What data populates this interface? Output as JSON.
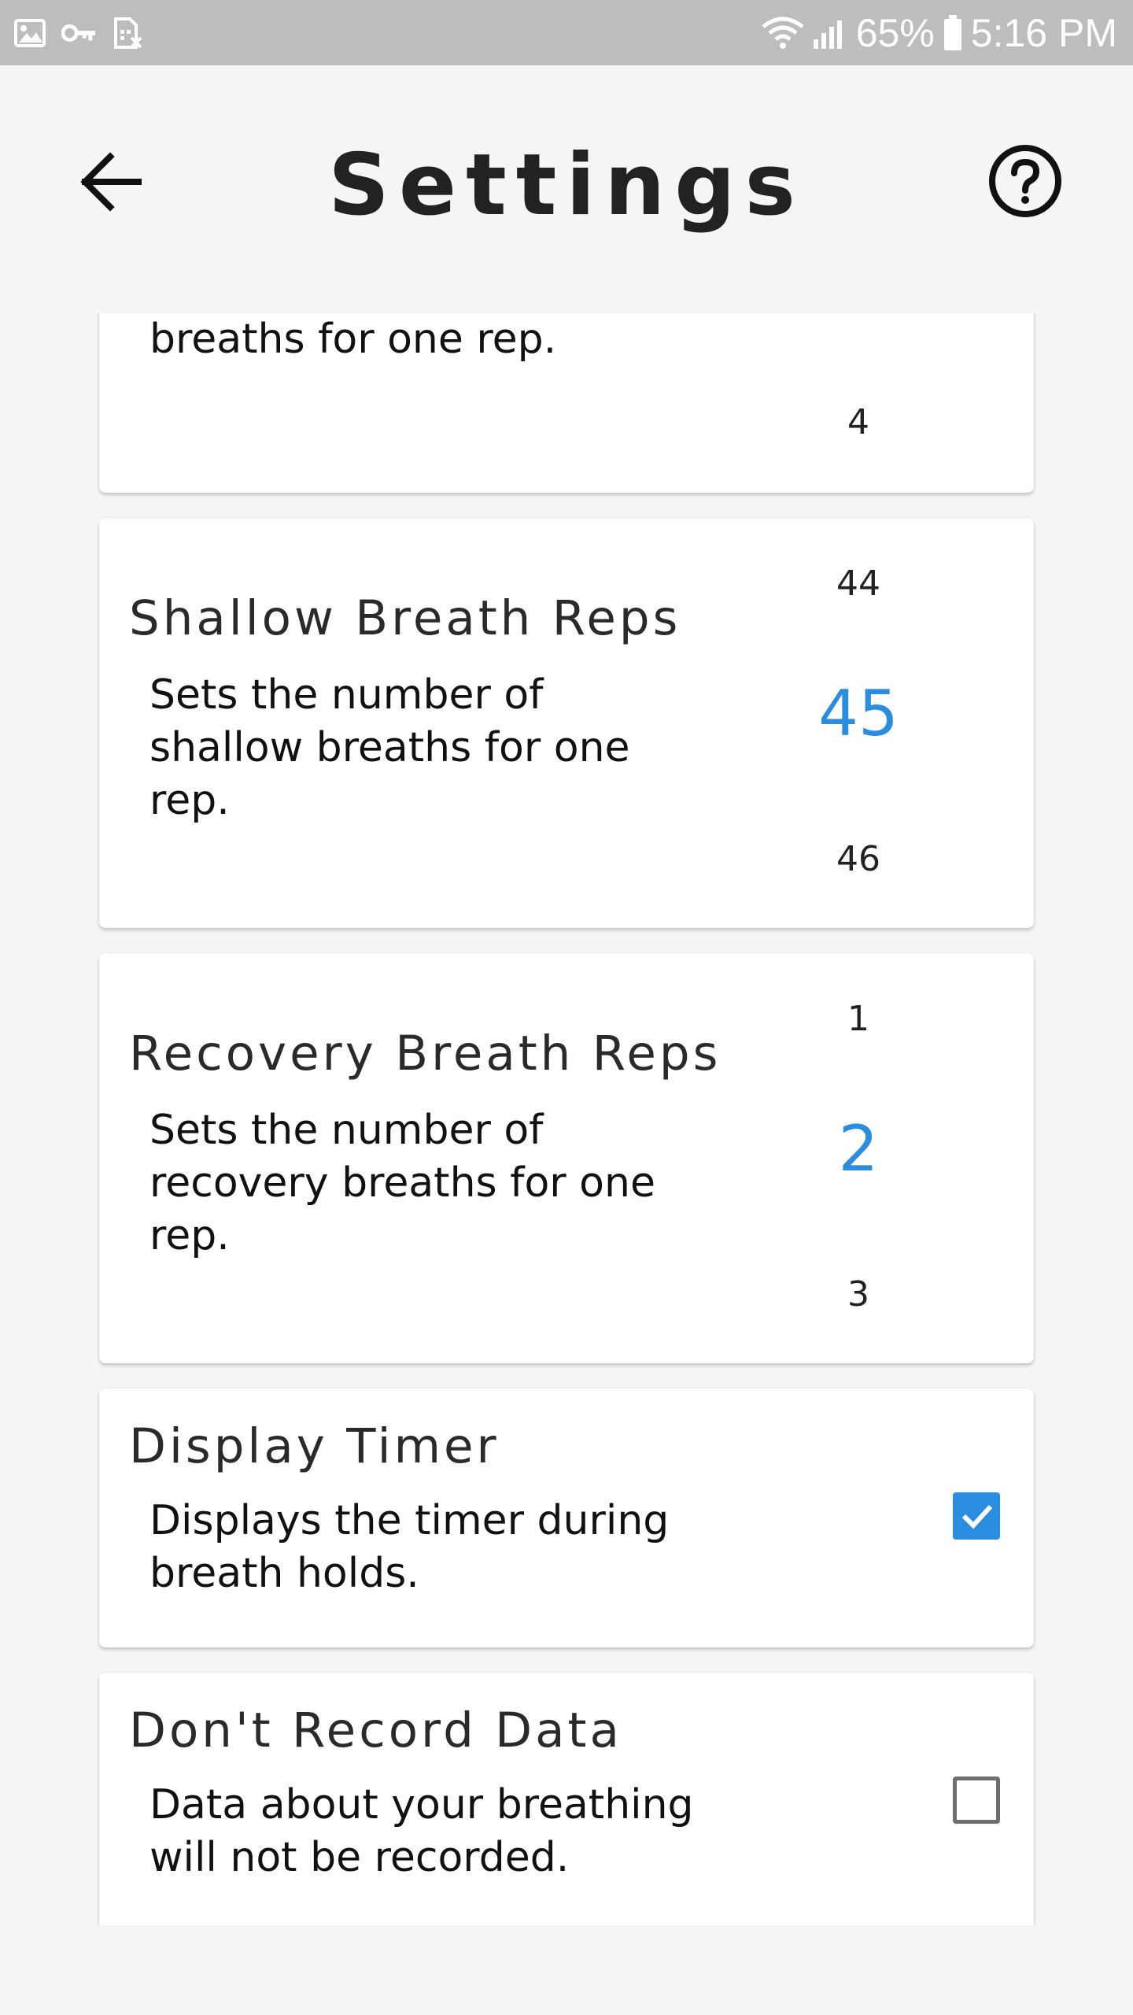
{
  "status_bar": {
    "battery_percent": "65%",
    "time": "5:16 PM",
    "left_icons": [
      "image-icon",
      "key-icon",
      "sim-off-icon"
    ],
    "right_icons": [
      "wifi-icon",
      "signal-icon",
      "battery-icon"
    ]
  },
  "header": {
    "title": "Settings",
    "back_icon": "arrow-left-icon",
    "help_icon": "help-circle-icon"
  },
  "settings": {
    "breath_reps_partial": {
      "desc": "breaths for one rep.",
      "picker_next": "4"
    },
    "shallow_breath_reps": {
      "title": "Shallow Breath Reps",
      "desc": "Sets the number of shallow breaths  for one rep.",
      "picker_prev": "44",
      "picker_value": "45",
      "picker_next": "46"
    },
    "recovery_breath_reps": {
      "title": "Recovery Breath Reps",
      "desc": "Sets the number of recovery breaths for one rep.",
      "picker_prev": "1",
      "picker_value": "2",
      "picker_next": "3"
    },
    "display_timer": {
      "title": "Display Timer",
      "desc": "Displays the timer during breath holds.",
      "checked": true
    },
    "dont_record_data": {
      "title": "Don't Record Data",
      "desc": "Data about your breathing will not be recorded.",
      "checked": false
    }
  },
  "colors": {
    "accent": "#2a8de0",
    "status_bar": "#bdbdbd",
    "background": "#f5f5f5",
    "card": "#ffffff"
  }
}
